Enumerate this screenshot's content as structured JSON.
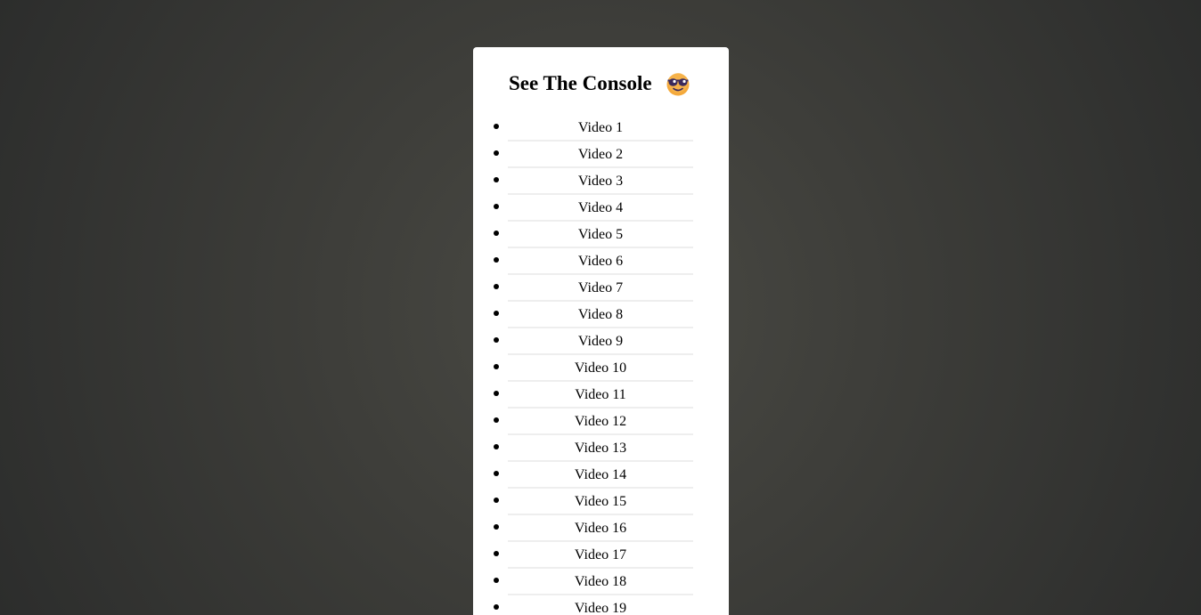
{
  "page": {
    "title": "See The Console"
  },
  "icons": {
    "title_emoji": "sunglasses-face-icon"
  },
  "colors": {
    "card_background": "#ffffff",
    "item_divider": "#eeeeee",
    "emoji_face": "#f4a93b",
    "emoji_glasses": "#3b2a5c"
  },
  "videos": [
    {
      "label": "Video 1"
    },
    {
      "label": "Video 2"
    },
    {
      "label": "Video 3"
    },
    {
      "label": "Video 4"
    },
    {
      "label": "Video 5"
    },
    {
      "label": "Video 6"
    },
    {
      "label": "Video 7"
    },
    {
      "label": "Video 8"
    },
    {
      "label": "Video 9"
    },
    {
      "label": "Video 10"
    },
    {
      "label": "Video 11"
    },
    {
      "label": "Video 12"
    },
    {
      "label": "Video 13"
    },
    {
      "label": "Video 14"
    },
    {
      "label": "Video 15"
    },
    {
      "label": "Video 16"
    },
    {
      "label": "Video 17"
    },
    {
      "label": "Video 18"
    },
    {
      "label": "Video 19"
    }
  ]
}
